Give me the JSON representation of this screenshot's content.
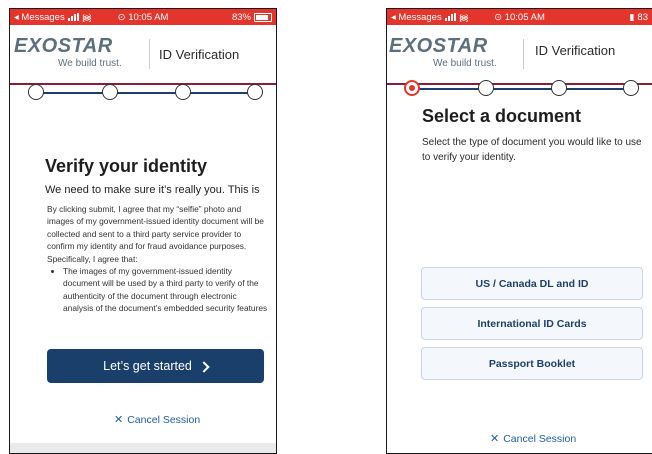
{
  "left": {
    "status": {
      "carrier": "◂ Messages",
      "time": "⊙ 10:05 AM",
      "battery": "83%"
    },
    "header": {
      "logo": "EXOSTAR",
      "tagline": "We build trust.",
      "title": "ID Verification"
    },
    "heading": "Verify your identity",
    "subheading": "We need to make sure it’s really you. This is",
    "consent_paragraph": "By clicking submit, I agree that my “selfie” photo and images of my government-issued identity document will be collected and sent to a third party service provider to confirm my identity and for fraud avoidance purposes. Specifically, I agree that:",
    "consent_bullet": "The images of my government-issued identity document will be used by a third party to verify of the authenticity of the document through electronic analysis of the document’s embedded security features",
    "start_button": "Let’s get started",
    "cancel": "Cancel Session"
  },
  "right": {
    "status": {
      "carrier": "◂ Messages",
      "time": "⊙ 10:05 AM",
      "battery": "83"
    },
    "header": {
      "logo": "EXOSTAR",
      "tagline": "We build trust.",
      "title": "ID Verification"
    },
    "heading": "Select a document",
    "description": "Select the type of document you would like to use to verify your identity.",
    "documents": [
      "US / Canada DL and ID",
      "International ID Cards",
      "Passport Booklet"
    ],
    "cancel": "Cancel Session"
  },
  "colors": {
    "status_bar": "#e3352b",
    "primary": "#1a3f6b",
    "link": "#1f5da0",
    "header_rule": "#8a1d3a"
  },
  "icons": {
    "wifi": "wifi-icon",
    "signal": "signal-icon",
    "battery": "battery-icon",
    "cancel": "close-icon",
    "next": "chevron-right-icon"
  }
}
